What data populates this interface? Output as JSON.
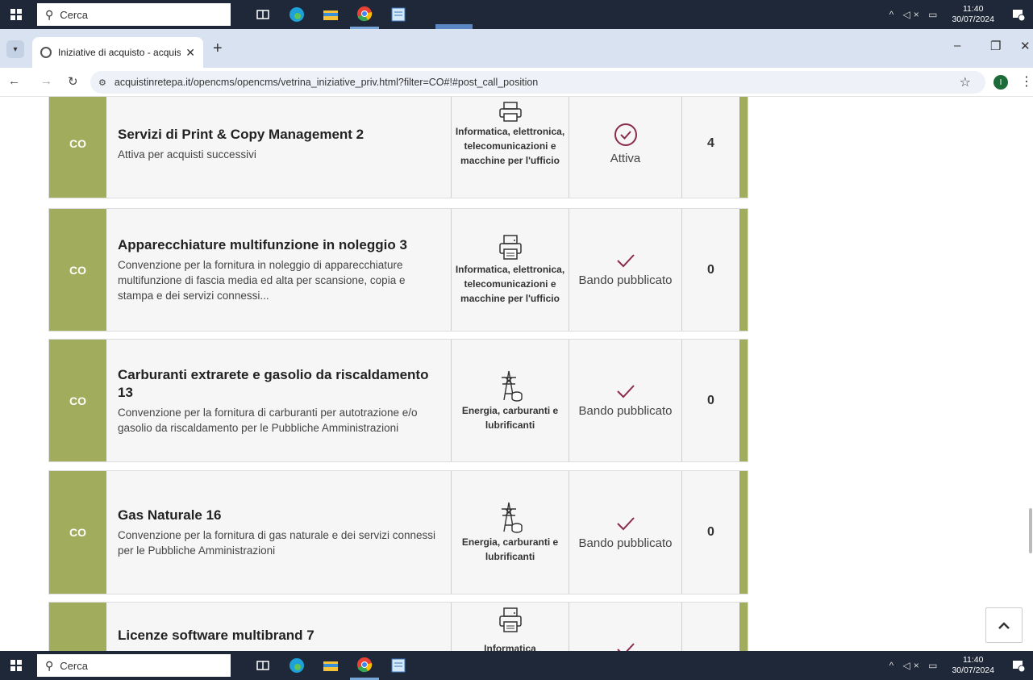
{
  "taskbar": {
    "search_placeholder": "Cerca",
    "time": "11:40",
    "date": "30/07/2024",
    "notif_count": "1"
  },
  "browser": {
    "tab_title": "Iniziative di acquisto - acquistin",
    "url": "acquistinretepa.it/opencms/opencms/vetrina_iniziative_priv.html?filter=CO#!#post_call_position",
    "profile_initial": "I"
  },
  "cards": [
    {
      "tag": "CO",
      "title": "Servizi di Print & Copy Management 2",
      "desc": "Attiva per acquisti successivi",
      "category": "Informatica, elettronica, telecomunicazioni e macchine per l'ufficio",
      "category_icon": "printer-icon",
      "status": "Attiva",
      "status_icon": "check-circle-icon",
      "count": "4"
    },
    {
      "tag": "CO",
      "title": "Apparecchiature multifunzione in noleggio 3",
      "desc": "Convenzione per la fornitura in noleggio di apparecchiature multifunzione di fascia media ed alta per scansione, copia e stampa e dei servizi connessi...",
      "category": "Informatica, elettronica, telecomunicazioni e macchine per l'ufficio",
      "category_icon": "printer-icon",
      "status": "Bando pubblicato",
      "status_icon": "check-icon",
      "count": "0"
    },
    {
      "tag": "CO",
      "title": "Carburanti extrarete e gasolio da riscaldamento 13",
      "desc": "Convenzione per la fornitura di carburanti per autotrazione e/o gasolio da riscaldamento per le Pubbliche Amministrazioni",
      "category": "Energia, carburanti e lubrificanti",
      "category_icon": "power-tower-icon",
      "status": "Bando pubblicato",
      "status_icon": "check-icon",
      "count": "0"
    },
    {
      "tag": "CO",
      "title": "Gas Naturale 16",
      "desc": "Convenzione per la fornitura di gas naturale e dei servizi connessi per le Pubbliche Amministrazioni",
      "category": "Energia, carburanti e lubrificanti",
      "category_icon": "power-tower-icon",
      "status": "Bando pubblicato",
      "status_icon": "check-icon",
      "count": "0"
    },
    {
      "tag": "",
      "title": "Licenze software multibrand 7",
      "desc": "",
      "category": "Informatica",
      "category_icon": "printer-icon",
      "status": "",
      "status_icon": "check-icon",
      "count": ""
    }
  ],
  "colors": {
    "accent_green": "#a1ad5c",
    "check_color": "#8a2b4d"
  }
}
